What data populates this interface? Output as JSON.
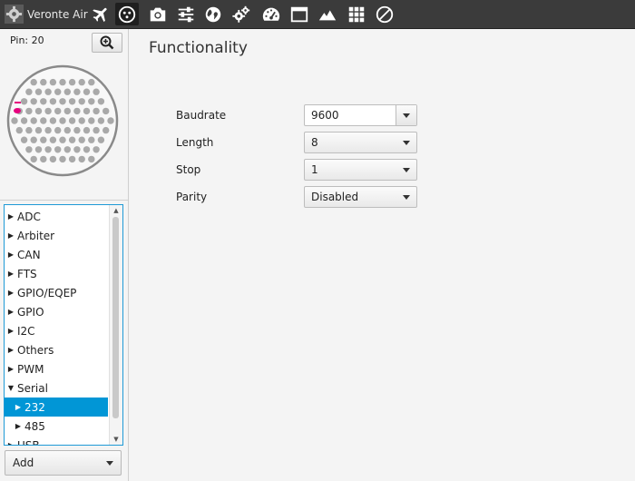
{
  "app": {
    "name": "Veronte Air"
  },
  "toolbar": {
    "icons": [
      "gear-icon",
      "airplane-icon",
      "connector-icon",
      "camera-icon",
      "sliders-icon",
      "globe-icon",
      "gears-icon",
      "gauge-icon",
      "window-icon",
      "mountain-icon",
      "grid-icon",
      "block-icon"
    ],
    "active": "connector-icon"
  },
  "left": {
    "pin_label": "Pin: 20",
    "highlight_color": "#e6007e",
    "tree": {
      "items": [
        {
          "label": "ADC",
          "expanded": false,
          "level": 0
        },
        {
          "label": "Arbiter",
          "expanded": false,
          "level": 0
        },
        {
          "label": "CAN",
          "expanded": false,
          "level": 0
        },
        {
          "label": "FTS",
          "expanded": false,
          "level": 0
        },
        {
          "label": "GPIO/EQEP",
          "expanded": false,
          "level": 0
        },
        {
          "label": "GPIO",
          "expanded": false,
          "level": 0
        },
        {
          "label": "I2C",
          "expanded": false,
          "level": 0
        },
        {
          "label": "Others",
          "expanded": false,
          "level": 0
        },
        {
          "label": "PWM",
          "expanded": false,
          "level": 0
        },
        {
          "label": "Serial",
          "expanded": true,
          "level": 0
        },
        {
          "label": "232",
          "expanded": false,
          "level": 1,
          "selected": true
        },
        {
          "label": "485",
          "expanded": false,
          "level": 1
        },
        {
          "label": "USB",
          "expanded": false,
          "level": 0
        }
      ]
    },
    "add_button": "Add"
  },
  "content": {
    "title": "Functionality",
    "fields": {
      "baudrate": {
        "label": "Baudrate",
        "value": "9600"
      },
      "length": {
        "label": "Length",
        "value": "8"
      },
      "stop": {
        "label": "Stop",
        "value": "1"
      },
      "parity": {
        "label": "Parity",
        "value": "Disabled"
      }
    }
  },
  "colors": {
    "accent": "#0196d6",
    "toolbar_bg": "#3b3b3b"
  }
}
